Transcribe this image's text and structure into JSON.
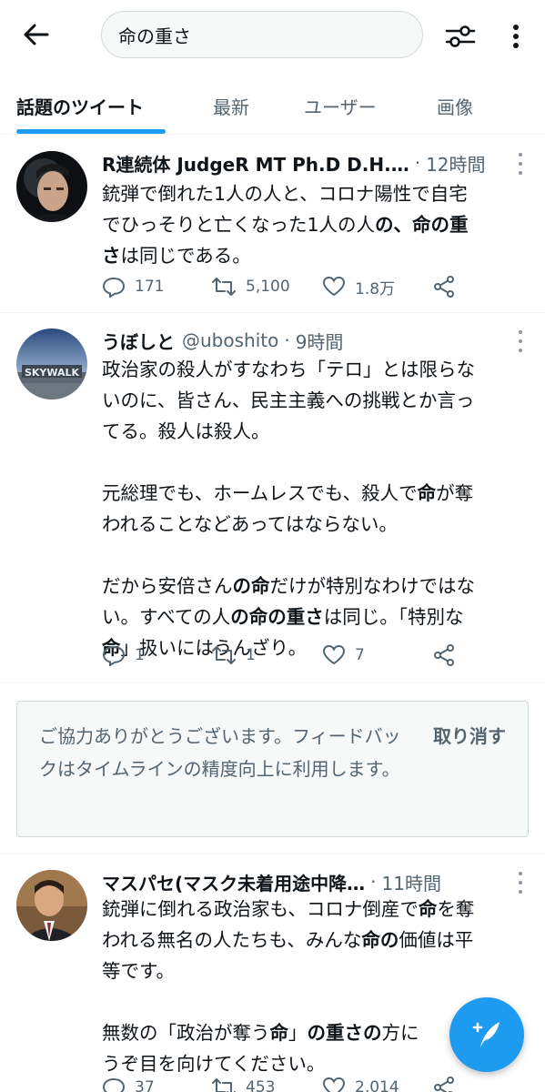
{
  "search": {
    "query": "命の重さ"
  },
  "tabs": [
    {
      "label": "話題のツイート",
      "active": true
    },
    {
      "label": "最新",
      "active": false
    },
    {
      "label": "ユーザー",
      "active": false
    },
    {
      "label": "画像",
      "active": false
    }
  ],
  "tweets": [
    {
      "name": "R連続体 JudgeR MT Ph.D D.H.…",
      "handle": "",
      "time": "12時間",
      "lines": [
        [
          "銃弾で倒れた1人の人と、コロナ陽性で自宅"
        ],
        [
          "でひっそりと亡くなった1人の人",
          "の、命の重"
        ],
        [
          "さ",
          "は同じである。"
        ]
      ],
      "replies": "171",
      "retweets": "5,100",
      "likes": "1.8万"
    },
    {
      "name": "うぼしと",
      "handle": "@uboshito",
      "time": "9時間",
      "lines": [
        [
          "政治家の殺人がすなわち「テロ」とは限らな"
        ],
        [
          "いのに、皆さん、民主主義への挑戦とか言っ"
        ],
        [
          "てる。殺人は殺人。"
        ],
        [],
        [
          "元総理でも、ホームレスでも、殺人で",
          "命",
          "が奪"
        ],
        [
          "われることなどあってはならない。"
        ],
        [],
        [
          "だから安倍さん",
          "の命",
          "だけが特別なわけではな"
        ],
        [
          "い。すべての人",
          "の命の重さ",
          "は同じ。「特別な"
        ],
        [
          "命",
          "」扱いにはうんざり。"
        ]
      ],
      "replies": "1",
      "retweets": "1",
      "likes": "7"
    },
    {
      "name": "マスパセ(マスク未着用途中降…",
      "handle": "",
      "time": "11時間",
      "lines": [
        [
          "銃弾に倒れる政治家も、コロナ倒産で",
          "命",
          "を奪"
        ],
        [
          "われる無名の人たちも、みんな",
          "命の",
          "価値は平"
        ],
        [
          "等です。"
        ],
        [],
        [
          "無数の「政治が奪う",
          "命",
          "」",
          "の重さの",
          "方に"
        ],
        [
          "うぞ目を向けてください。"
        ]
      ],
      "replies": "37",
      "retweets": "453",
      "likes": "2,014"
    }
  ],
  "feedback": {
    "text": "ご協力ありがとうございます。フィードバックはタイムラインの精度向上に利用します。",
    "undo": "取り消す"
  },
  "colors": {
    "accent": "#1d9bf0",
    "secondary_text": "#536471",
    "primary_text": "#0f1419"
  },
  "icons": [
    "back-arrow-icon",
    "search-filter-icon",
    "more-vertical-icon",
    "reply-icon",
    "retweet-icon",
    "like-icon",
    "share-icon",
    "compose-tweet-icon"
  ]
}
